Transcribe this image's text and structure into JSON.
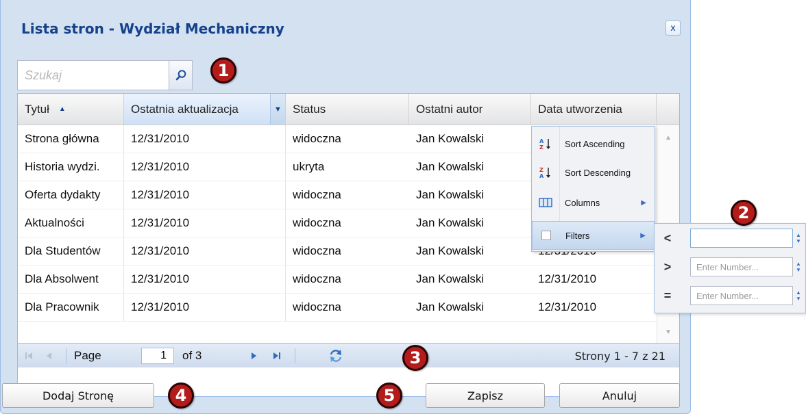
{
  "window": {
    "title": "Lista stron - Wydział Mechaniczny",
    "close_label": "x"
  },
  "search": {
    "placeholder": "Szukaj",
    "value": ""
  },
  "callouts": [
    "1",
    "2",
    "3",
    "4",
    "5"
  ],
  "grid": {
    "columns": [
      "Tytuł",
      "Ostatnia aktualizacja",
      "Status",
      "Ostatni autor",
      "Data utworzenia"
    ],
    "sort_column": "Tytuł",
    "sort_direction": "ascending",
    "rows": [
      [
        "Strona główna",
        "12/31/2010",
        "widoczna",
        "Jan Kowalski",
        ""
      ],
      [
        "Historia wydzi.",
        "12/31/2010",
        "ukryta",
        "Jan Kowalski",
        ""
      ],
      [
        "Oferta dydakty",
        "12/31/2010",
        "widoczna",
        "Jan Kowalski",
        ""
      ],
      [
        "Aktualności",
        "12/31/2010",
        "widoczna",
        "Jan Kowalski",
        ""
      ],
      [
        "Dla Studentów",
        "12/31/2010",
        "widoczna",
        "Jan Kowalski",
        "12/31/2010"
      ],
      [
        "Dla Absolwent",
        "12/31/2010",
        "widoczna",
        "Jan Kowalski",
        "12/31/2010"
      ],
      [
        "Dla Pracownik",
        "12/31/2010",
        "widoczna",
        "Jan Kowalski",
        "12/31/2010"
      ]
    ]
  },
  "column_menu": {
    "items": [
      {
        "label": "Sort Ascending",
        "icon": "sort-ascending-icon"
      },
      {
        "label": "Sort Descending",
        "icon": "sort-descending-icon"
      },
      {
        "label": "Columns",
        "icon": "columns-icon"
      },
      {
        "label": "Filters",
        "icon": "checkbox-icon"
      }
    ]
  },
  "filter_submenu": {
    "rows": [
      {
        "operator": "<",
        "value": "",
        "placeholder": ""
      },
      {
        "operator": ">",
        "value": "",
        "placeholder": "Enter Number..."
      },
      {
        "operator": "=",
        "value": "",
        "placeholder": "Enter Number..."
      }
    ]
  },
  "pager": {
    "page_label": "Page",
    "current_page": "1",
    "of_label": "of 3",
    "display": "Strony 1 - 7 z 21"
  },
  "buttons": {
    "add_page": "Dodaj Stronę",
    "save": "Zapisz",
    "cancel": "Anuluj"
  },
  "colors": {
    "accent": "#15428b",
    "window_bg": "#d3e1f1",
    "callout": "#b41b1b"
  }
}
